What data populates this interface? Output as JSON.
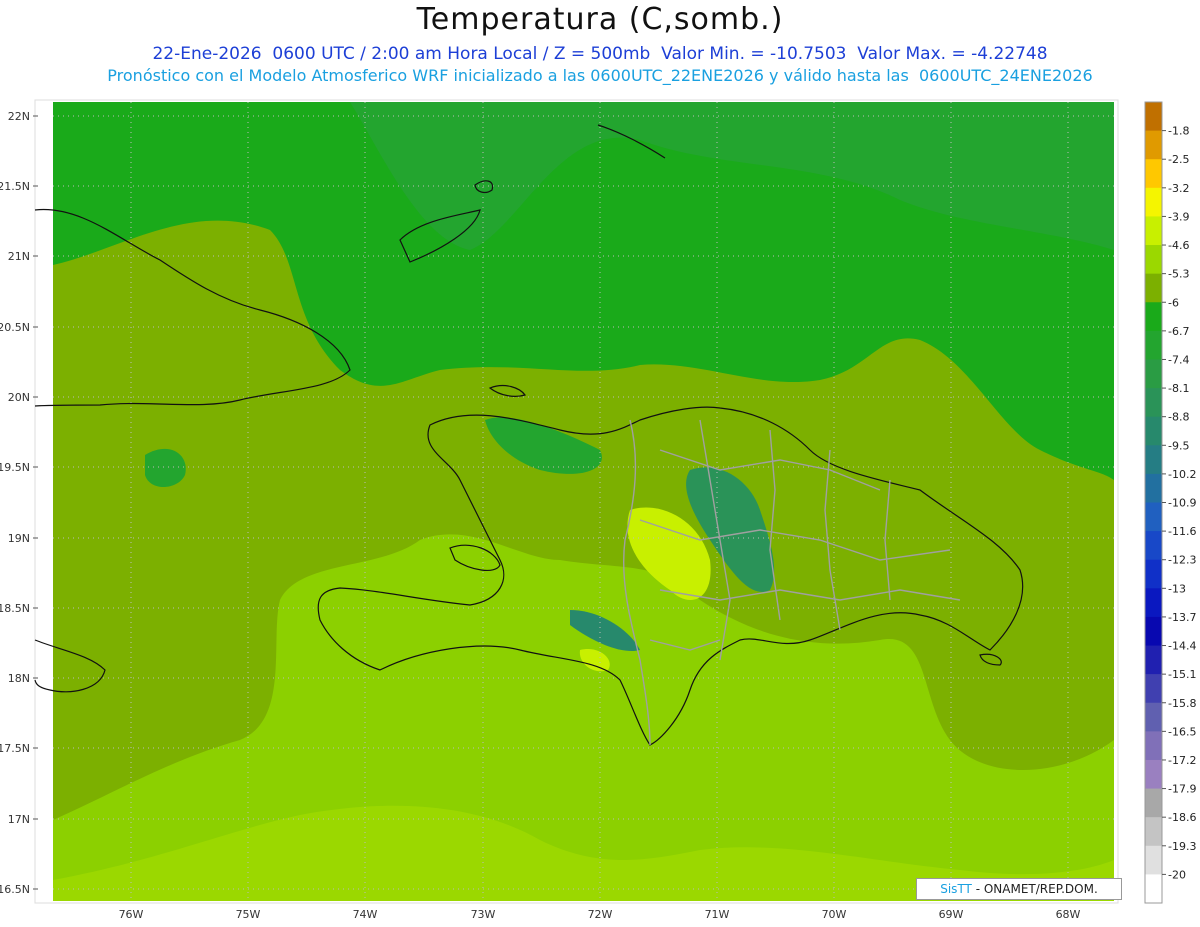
{
  "header": {
    "title": "Temperatura (C,somb.)",
    "line1": "22-Ene-2026  0600 UTC / 2:00 am Hora Local / Z = 500mb  Valor Min. = -10.7503  Valor Max. = -4.22748",
    "line2": "Pronóstico con el Modelo Atmosferico WRF inicializado a las 0600UTC_22ENE2026 y válido hasta las  0600UTC_24ENE2026"
  },
  "axes": {
    "lat_labels": [
      "22N",
      "21.5N",
      "21N",
      "20.5N",
      "20N",
      "19.5N",
      "19N",
      "18.5N",
      "18N",
      "17.5N",
      "17N",
      "16.5N"
    ],
    "lon_labels": [
      "76W",
      "75W",
      "74W",
      "73W",
      "72W",
      "71W",
      "70W",
      "69W",
      "68W"
    ]
  },
  "colorbar": {
    "labels": [
      "-1.8",
      "-2.5",
      "-3.2",
      "-3.9",
      "-4.6",
      "-5.3",
      "-6",
      "-6.7",
      "-7.4",
      "-8.1",
      "-8.8",
      "-9.5",
      "-10.2",
      "-10.9",
      "-11.6",
      "-12.3",
      "-13",
      "-13.7",
      "-14.4",
      "-15.1",
      "-15.8",
      "-16.5",
      "-17.2",
      "-17.9",
      "-18.6",
      "-19.3",
      "-20"
    ],
    "colors": [
      "#c07000",
      "#e09a00",
      "#ffc800",
      "#f5f500",
      "#c8f000",
      "#9bd800",
      "#7cb000",
      "#1aaa1a",
      "#23a52f",
      "#2a9c44",
      "#2a9358",
      "#27896c",
      "#257d84",
      "#2270a0",
      "#2060c0",
      "#1848c8",
      "#1030c8",
      "#0a18c0",
      "#0808b0",
      "#2020b0",
      "#4040b0",
      "#6060b0",
      "#8070b8",
      "#9a80c0",
      "#a8a8a8",
      "#c4c4c4",
      "#e0e0e0",
      "#ffffff"
    ]
  },
  "credit": {
    "brand": "SisTT",
    "text": "- ONAMET/REP.DOM."
  }
}
